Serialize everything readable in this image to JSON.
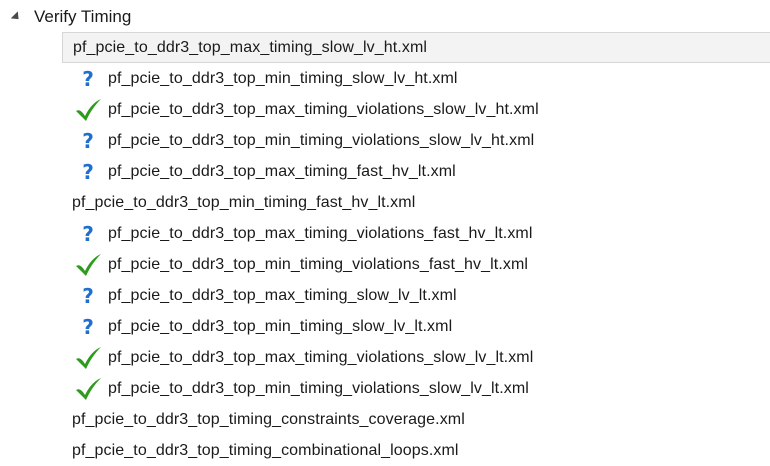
{
  "tree": {
    "root_label": "Verify Timing",
    "items": [
      {
        "label": "pf_pcie_to_ddr3_top_max_timing_slow_lv_ht.xml",
        "status": "none",
        "selected": true
      },
      {
        "label": "pf_pcie_to_ddr3_top_min_timing_slow_lv_ht.xml",
        "status": "question-icon",
        "selected": false
      },
      {
        "label": "pf_pcie_to_ddr3_top_max_timing_violations_slow_lv_ht.xml",
        "status": "check-icon",
        "selected": false
      },
      {
        "label": "pf_pcie_to_ddr3_top_min_timing_violations_slow_lv_ht.xml",
        "status": "question-icon",
        "selected": false
      },
      {
        "label": "pf_pcie_to_ddr3_top_max_timing_fast_hv_lt.xml",
        "status": "question-icon",
        "selected": false
      },
      {
        "label": "pf_pcie_to_ddr3_top_min_timing_fast_hv_lt.xml",
        "status": "none",
        "selected": false
      },
      {
        "label": "pf_pcie_to_ddr3_top_max_timing_violations_fast_hv_lt.xml",
        "status": "question-icon",
        "selected": false
      },
      {
        "label": "pf_pcie_to_ddr3_top_min_timing_violations_fast_hv_lt.xml",
        "status": "check-icon",
        "selected": false
      },
      {
        "label": "pf_pcie_to_ddr3_top_max_timing_slow_lv_lt.xml",
        "status": "question-icon",
        "selected": false
      },
      {
        "label": "pf_pcie_to_ddr3_top_min_timing_slow_lv_lt.xml",
        "status": "question-icon",
        "selected": false
      },
      {
        "label": "pf_pcie_to_ddr3_top_max_timing_violations_slow_lv_lt.xml",
        "status": "check-icon",
        "selected": false
      },
      {
        "label": "pf_pcie_to_ddr3_top_min_timing_violations_slow_lv_lt.xml",
        "status": "check-icon",
        "selected": false
      },
      {
        "label": "pf_pcie_to_ddr3_top_timing_constraints_coverage.xml",
        "status": "none",
        "selected": false
      },
      {
        "label": "pf_pcie_to_ddr3_top_timing_combinational_loops.xml",
        "status": "none",
        "selected": false
      }
    ]
  },
  "colors": {
    "question_icon": "#1e6fd0",
    "check_icon": "#2e9a1e",
    "selection_background": "#f3f3f3",
    "selection_border": "#d6d6d6"
  }
}
